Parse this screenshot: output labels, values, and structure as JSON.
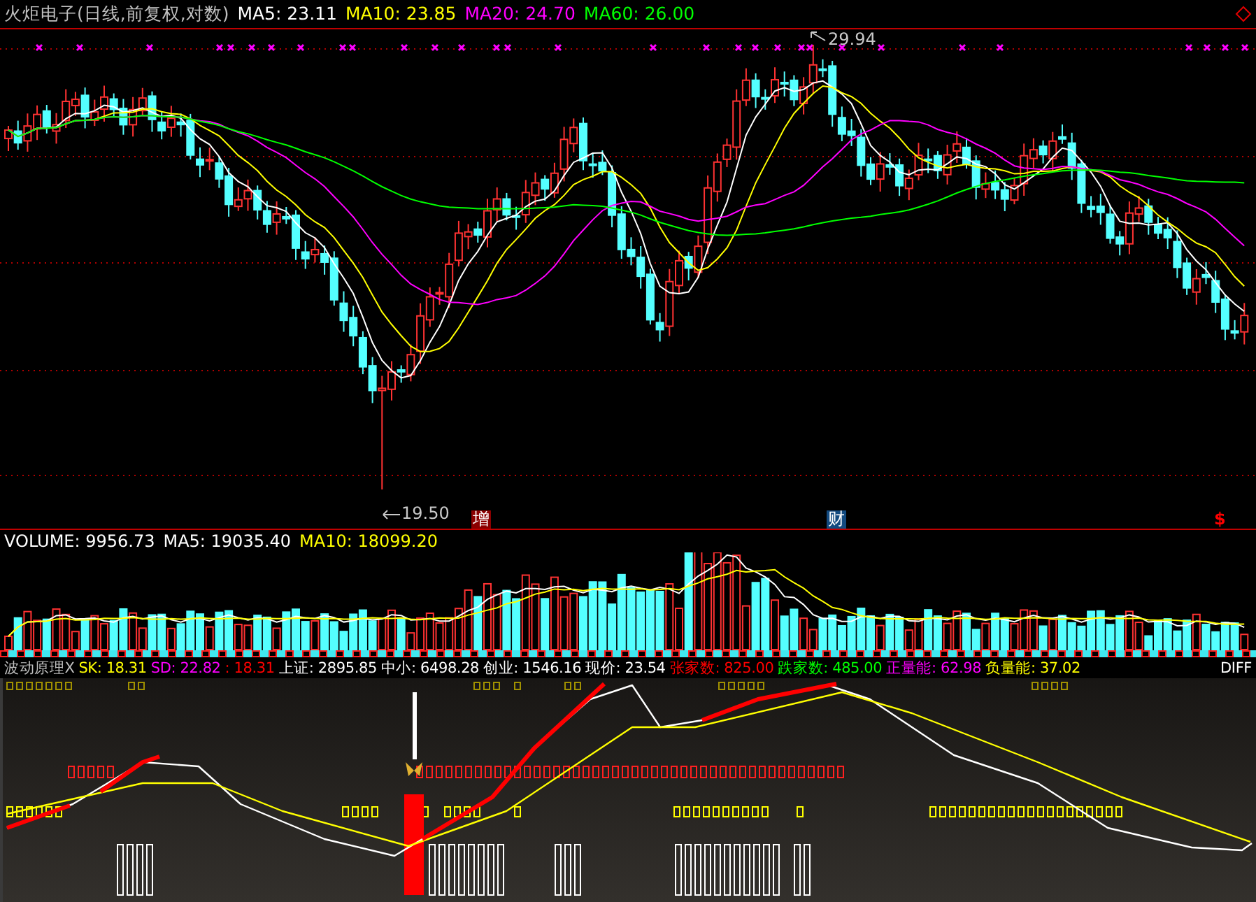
{
  "price_panel": {
    "title": "火炬电子(日线,前复权,对数)",
    "indicators": [
      {
        "label": "MA5: 23.11",
        "color": "#ffffff"
      },
      {
        "label": "MA10: 23.85",
        "color": "#ffff00"
      },
      {
        "label": "MA20: 24.70",
        "color": "#ff00ff"
      },
      {
        "label": "MA60: 26.00",
        "color": "#00ff00"
      }
    ],
    "high_label": "29.94",
    "low_label": "19.50",
    "event_markers": [
      {
        "kind": "tag",
        "text": "增",
        "color": "#8b0000"
      },
      {
        "kind": "tag",
        "text": "财",
        "color": "#124a80"
      },
      {
        "kind": "symbol",
        "text": "$",
        "color": "#ff0000"
      }
    ]
  },
  "volume_panel": {
    "indicators": [
      {
        "label": "VOLUME: 9956.73",
        "color": "#ffffff"
      },
      {
        "label": "MA5: 19035.40",
        "color": "#ffffff"
      },
      {
        "label": "MA10: 18099.20",
        "color": "#ffff00"
      }
    ]
  },
  "indicator_panel": {
    "title": "波动原理X",
    "readings": [
      {
        "label": "SK: 18.31",
        "color": "#ffff00"
      },
      {
        "label": "SD: 22.82",
        "color": "#ff00ff"
      },
      {
        "label": ": 18.31",
        "color": "#ff0000"
      },
      {
        "label": "上证: 2895.85",
        "color": "#ffffff"
      },
      {
        "label": "中小: 6498.28",
        "color": "#ffffff"
      },
      {
        "label": "创业: 1546.16",
        "color": "#ffffff"
      },
      {
        "label": "现价: 23.54",
        "color": "#ffffff"
      },
      {
        "label": "张家数: 825.00",
        "color": "#ff0000"
      },
      {
        "label": "跌家数: 485.00",
        "color": "#00ff00"
      },
      {
        "label": "正量能: 62.98",
        "color": "#ff00ff"
      },
      {
        "label": "负量能: 37.02",
        "color": "#ffff00"
      }
    ],
    "right_label": "DIFF"
  }
}
